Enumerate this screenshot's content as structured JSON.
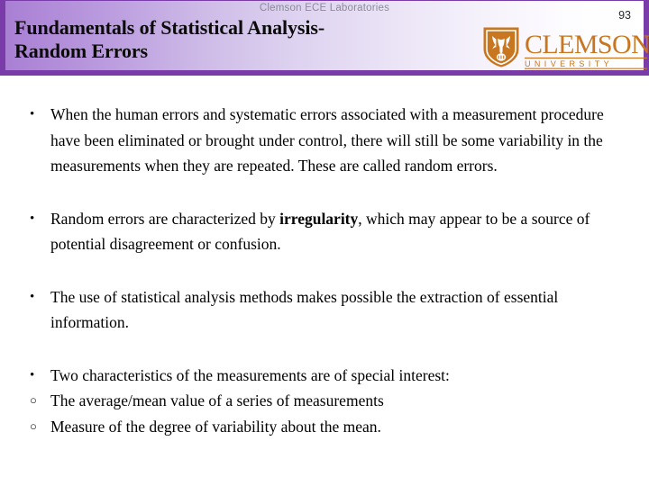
{
  "header": {
    "eyebrow": "Clemson ECE Laboratories",
    "page_number": "93",
    "title_line1": "Fundamentals of Statistical Analysis-",
    "title_line2": "Random Errors",
    "logo": {
      "name": "clemson-university-logo",
      "wordmark": "CLEMSON",
      "subtitle": "U N I V E R S I T Y",
      "color": "#C8761F"
    },
    "colors": {
      "border_purple": "#7A3CA8",
      "gradient_start": "#A97FD4",
      "gradient_end": "#FFFFFF",
      "eyebrow_text": "#8B8B98"
    }
  },
  "body": {
    "bullets": [
      {
        "marker": "bullet-dot",
        "glyph": "•",
        "text": "When the human errors and systematic errors associated with a measurement procedure have been eliminated or brought under control, there will still be some variability in the measurements when they are repeated. These are called random errors."
      },
      {
        "marker": "bullet-dot",
        "glyph": "•",
        "text_before": "Random errors are characterized by ",
        "bold_term": "irregularity",
        "text_after": ", which may appear to be a source of potential disagreement or confusion."
      },
      {
        "marker": "bullet-dot",
        "glyph": "•",
        "text": "The use of statistical analysis methods makes possible the extraction of essential information."
      },
      {
        "marker": "bullet-dot",
        "glyph": "•",
        "text": "Two characteristics of the measurements are of special interest:"
      },
      {
        "marker": "bullet-circle",
        "glyph": "○",
        "text": "The average/mean value of a series of measurements"
      },
      {
        "marker": "bullet-circle",
        "glyph": "○",
        "text": "Measure of the degree of variability about the mean."
      }
    ]
  }
}
